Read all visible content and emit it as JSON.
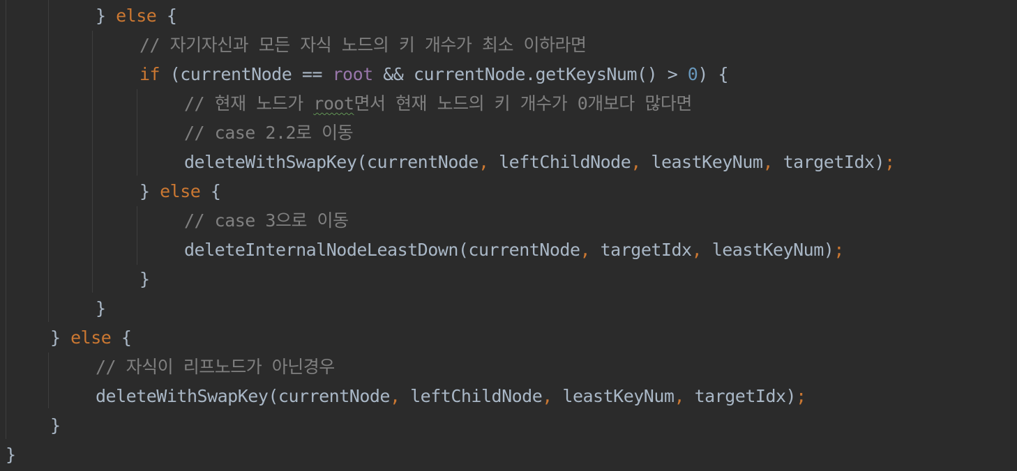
{
  "theme": {
    "background": "#2b2b2b",
    "default_text": "#a9b7c6",
    "keyword": "#cc7832",
    "comment": "#808080",
    "field": "#9876aa",
    "number": "#6897bb",
    "spell_underline": "#629755"
  },
  "lines": [
    {
      "indent": 2,
      "tokens": [
        {
          "t": "} ",
          "c": "plain"
        },
        {
          "t": "else",
          "c": "kw"
        },
        {
          "t": " {",
          "c": "plain"
        }
      ]
    },
    {
      "indent": 3,
      "tokens": [
        {
          "t": "// 자기자신과 모든 자식 노드의 키 개수가 최소 이하라면",
          "c": "cm"
        }
      ]
    },
    {
      "indent": 3,
      "tokens": [
        {
          "t": "if",
          "c": "kw"
        },
        {
          "t": " (currentNode == ",
          "c": "plain"
        },
        {
          "t": "root",
          "c": "fld"
        },
        {
          "t": " && currentNode.getKeysNum() > ",
          "c": "plain"
        },
        {
          "t": "0",
          "c": "num"
        },
        {
          "t": ") {",
          "c": "plain"
        }
      ]
    },
    {
      "indent": 4,
      "tokens": [
        {
          "t": "// 현재 노드가 ",
          "c": "cm"
        },
        {
          "t": "root",
          "c": "cm",
          "typo": true
        },
        {
          "t": "면서 현재 노드의 키 개수가 0개보다 많다면",
          "c": "cm"
        }
      ]
    },
    {
      "indent": 4,
      "tokens": [
        {
          "t": "// case 2.2로 이동",
          "c": "cm"
        }
      ]
    },
    {
      "indent": 4,
      "tokens": [
        {
          "t": "deleteWithSwapKey(currentNode",
          "c": "plain"
        },
        {
          "t": ",",
          "c": "punct"
        },
        {
          "t": " leftChildNode",
          "c": "plain"
        },
        {
          "t": ",",
          "c": "punct"
        },
        {
          "t": " leastKeyNum",
          "c": "plain"
        },
        {
          "t": ",",
          "c": "punct"
        },
        {
          "t": " targetIdx)",
          "c": "plain"
        },
        {
          "t": ";",
          "c": "punct"
        }
      ]
    },
    {
      "indent": 3,
      "tokens": [
        {
          "t": "} ",
          "c": "plain"
        },
        {
          "t": "else",
          "c": "kw"
        },
        {
          "t": " {",
          "c": "plain"
        }
      ]
    },
    {
      "indent": 4,
      "tokens": [
        {
          "t": "// case 3으로 이동",
          "c": "cm"
        }
      ]
    },
    {
      "indent": 4,
      "tokens": [
        {
          "t": "deleteInternalNodeLeastDown(currentNode",
          "c": "plain"
        },
        {
          "t": ",",
          "c": "punct"
        },
        {
          "t": " targetIdx",
          "c": "plain"
        },
        {
          "t": ",",
          "c": "punct"
        },
        {
          "t": " leastKeyNum)",
          "c": "plain"
        },
        {
          "t": ";",
          "c": "punct"
        }
      ]
    },
    {
      "indent": 3,
      "tokens": [
        {
          "t": "}",
          "c": "plain"
        }
      ]
    },
    {
      "indent": 2,
      "tokens": [
        {
          "t": "}",
          "c": "plain"
        }
      ]
    },
    {
      "indent": 1,
      "tokens": [
        {
          "t": "} ",
          "c": "plain"
        },
        {
          "t": "else",
          "c": "kw"
        },
        {
          "t": " {",
          "c": "plain"
        }
      ]
    },
    {
      "indent": 2,
      "tokens": [
        {
          "t": "// 자식이 리프노드가 아닌경우",
          "c": "cm"
        }
      ]
    },
    {
      "indent": 2,
      "tokens": [
        {
          "t": "deleteWithSwapKey(currentNode",
          "c": "plain"
        },
        {
          "t": ",",
          "c": "punct"
        },
        {
          "t": " leftChildNode",
          "c": "plain"
        },
        {
          "t": ",",
          "c": "punct"
        },
        {
          "t": " leastKeyNum",
          "c": "plain"
        },
        {
          "t": ",",
          "c": "punct"
        },
        {
          "t": " targetIdx)",
          "c": "plain"
        },
        {
          "t": ";",
          "c": "punct"
        }
      ]
    },
    {
      "indent": 1,
      "tokens": [
        {
          "t": "}",
          "c": "plain"
        }
      ]
    },
    {
      "indent": 0,
      "tokens": [
        {
          "t": "}",
          "c": "plain"
        }
      ]
    }
  ]
}
